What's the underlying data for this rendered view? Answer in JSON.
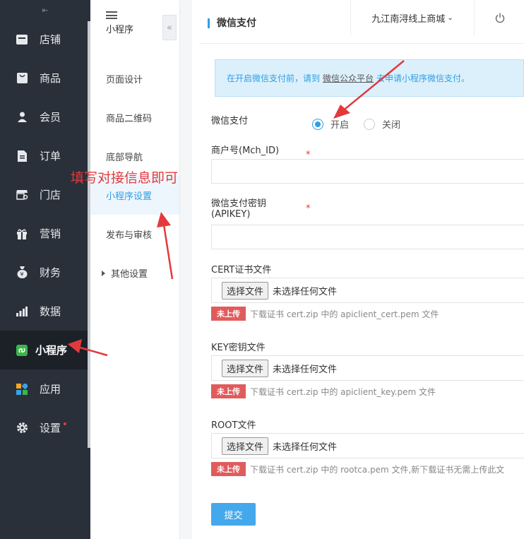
{
  "sidebar": {
    "collapse_icon": "collapse-left-icon",
    "items": [
      {
        "label": "店铺",
        "icon": "store-icon"
      },
      {
        "label": "商品",
        "icon": "bag-icon"
      },
      {
        "label": "会员",
        "icon": "user-icon"
      },
      {
        "label": "订单",
        "icon": "document-icon"
      },
      {
        "label": "门店",
        "icon": "shop-front-icon"
      },
      {
        "label": "营销",
        "icon": "gift-icon"
      },
      {
        "label": "财务",
        "icon": "money-bag-icon"
      },
      {
        "label": "数据",
        "icon": "bar-chart-icon"
      },
      {
        "label": "小程序",
        "icon": "mini-program-icon",
        "active": true
      },
      {
        "label": "应用",
        "icon": "apps-icon"
      },
      {
        "label": "设置",
        "icon": "gear-icon"
      }
    ]
  },
  "subnav": {
    "title": "小程序",
    "items": [
      {
        "label": "页面设计"
      },
      {
        "label": "商品二维码"
      },
      {
        "label": "底部导航"
      },
      {
        "label": "小程序设置",
        "active": true
      },
      {
        "label": "发布与审核"
      },
      {
        "label": "其他设置"
      }
    ]
  },
  "header": {
    "title": "微信支付",
    "shop_name": "九江南浔线上商城"
  },
  "notice": {
    "prefix": "在开启微信支付前，请到",
    "link": "微信公众平台",
    "suffix": "去申请小程序微信支付。"
  },
  "form": {
    "wxpay_label": "微信支付",
    "radio_on": "开启",
    "radio_off": "关闭",
    "mch_label": "商户号(Mch_ID)",
    "apikey_label_1": "微信支付密钥",
    "apikey_label_2": "(APIKEY)",
    "cert_label": "CERT证书文件",
    "key_label": "KEY密钥文件",
    "root_label": "ROOT文件",
    "choose_file": "选择文件",
    "no_file": "未选择任何文件",
    "badge": "未上传",
    "cert_hint": "下载证书 cert.zip 中的 apiclient_cert.pem 文件",
    "key_hint": "下载证书 cert.zip 中的 apiclient_key.pem 文件",
    "root_hint": "下载证书 cert.zip 中的 rootca.pem 文件,新下载证书无需上传此文",
    "submit": "提交",
    "required_mark": "*"
  },
  "annotation": "填写对接信息即可",
  "colors": {
    "accent": "#2d9fe6",
    "annotation": "#e4393c",
    "sidebar": "#2a3039"
  }
}
